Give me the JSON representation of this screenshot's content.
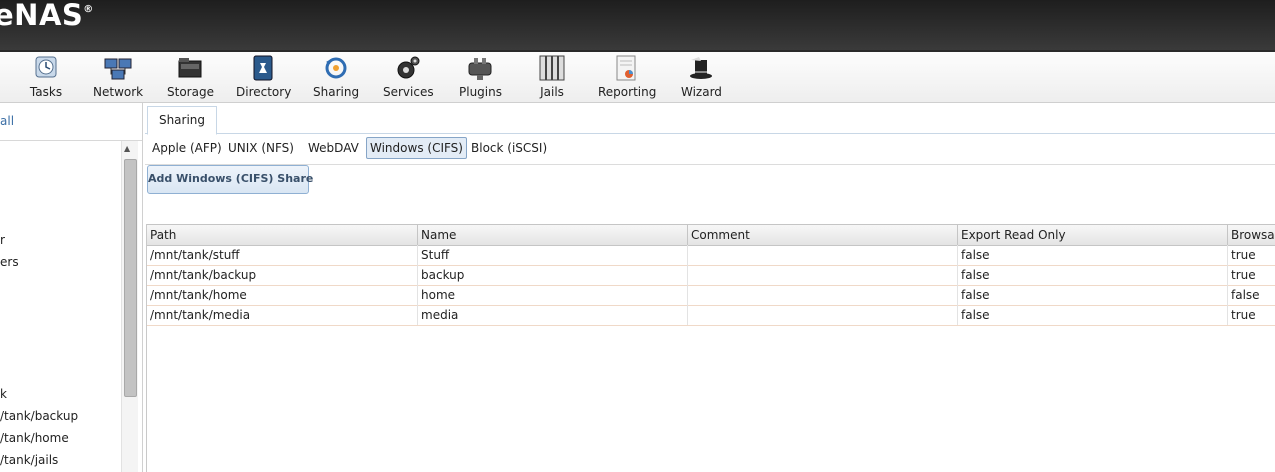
{
  "header": {
    "logo_text": "eNAS",
    "logo_mark": "®"
  },
  "toolbar": {
    "items": [
      {
        "label": "Tasks",
        "icon": "tasks-icon"
      },
      {
        "label": "Network",
        "icon": "network-icon"
      },
      {
        "label": "Storage",
        "icon": "storage-icon"
      },
      {
        "label": "Directory",
        "icon": "directory-icon"
      },
      {
        "label": "Sharing",
        "icon": "sharing-icon"
      },
      {
        "label": "Services",
        "icon": "services-icon"
      },
      {
        "label": "Plugins",
        "icon": "plugins-icon"
      },
      {
        "label": "Jails",
        "icon": "jails-icon"
      },
      {
        "label": "Reporting",
        "icon": "reporting-icon"
      },
      {
        "label": "Wizard",
        "icon": "wizard-icon"
      }
    ]
  },
  "leftpane": {
    "collapse_text": "all",
    "items": [
      "r",
      "ers",
      "k",
      "/tank/backup",
      "/tank/home",
      "/tank/jails"
    ]
  },
  "main": {
    "tab": "Sharing",
    "subtabs": [
      "Apple (AFP)",
      "UNIX (NFS)",
      "WebDAV",
      "Windows (CIFS)",
      "Block (iSCSI)"
    ],
    "active_subtab": "Windows (CIFS)",
    "add_button": "Add Windows (CIFS) Share",
    "columns": [
      "Path",
      "Name",
      "Comment",
      "Export Read Only",
      "Browsab"
    ],
    "rows": [
      [
        "/mnt/tank/stuff",
        "Stuff",
        "",
        "false",
        "true"
      ],
      [
        "/mnt/tank/backup",
        "backup",
        "",
        "false",
        "true"
      ],
      [
        "/mnt/tank/home",
        "home",
        "",
        "false",
        "false"
      ],
      [
        "/mnt/tank/media",
        "media",
        "",
        "false",
        "true"
      ]
    ]
  },
  "colors": {
    "accent": "#86a5c7",
    "header_bg": "#2a2a2a",
    "row_border": "#f0d9c8"
  }
}
